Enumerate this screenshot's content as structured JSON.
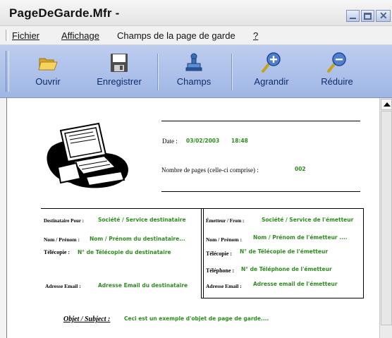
{
  "window": {
    "title": "PageDeGarde.Mfr -"
  },
  "menu": {
    "items": [
      {
        "label": "Fichier"
      },
      {
        "label": "Affichage"
      },
      {
        "label": "Champs de la page de garde"
      },
      {
        "label": "?"
      }
    ]
  },
  "toolbar": {
    "buttons": [
      {
        "label": "Ouvrir",
        "icon": "folder-open-icon"
      },
      {
        "label": "Enregistrer",
        "icon": "floppy-disk-icon"
      },
      {
        "label": "Champs",
        "icon": "stamp-icon"
      },
      {
        "label": "Agrandir",
        "icon": "zoom-in-icon"
      },
      {
        "label": "Réduire",
        "icon": "zoom-out-icon"
      }
    ]
  },
  "document": {
    "date_label": "Date :",
    "date_value": "03/02/2003",
    "time_value": "18:48",
    "pages_label": "Nombre de pages (celle-ci comprise) :",
    "pages_value": "002",
    "recipient": {
      "dest_label": "Destinataire Pour :",
      "dest_value": "Société / Service destinataire",
      "name_label": "Nom / Prénom :",
      "name_value": "Nom / Prénom du destinataire...",
      "fax_label": "Télécopie :",
      "fax_value": "N° de Télécopie du destinataire",
      "email_label": "Adresse Email :",
      "email_value": "Adresse Email du destinataire"
    },
    "sender": {
      "from_label": "Émetteur / From :",
      "from_value": "Société / Service de l'émetteur",
      "name_label": "Nom / Prénom :",
      "name_value": "Nom / Prénom de l'émetteur ....",
      "fax_label": "Télécopie :",
      "fax_value": "N° de Télécopie de l'émetteur",
      "phone_label": "Téléphone :",
      "phone_value": "N° de Téléphone de l'émetteur",
      "email_label": "Adresse Email :",
      "email_value": "Adresse email de l'émetteur"
    },
    "subject_label": "Objet / Subject :",
    "subject_value": "Ceci est un exemple d'objet de page de garde...."
  },
  "colors": {
    "toolbar_bg": "#adc1ea",
    "field_value": "#2d8c1f",
    "label_text": "#0b2c6e"
  }
}
